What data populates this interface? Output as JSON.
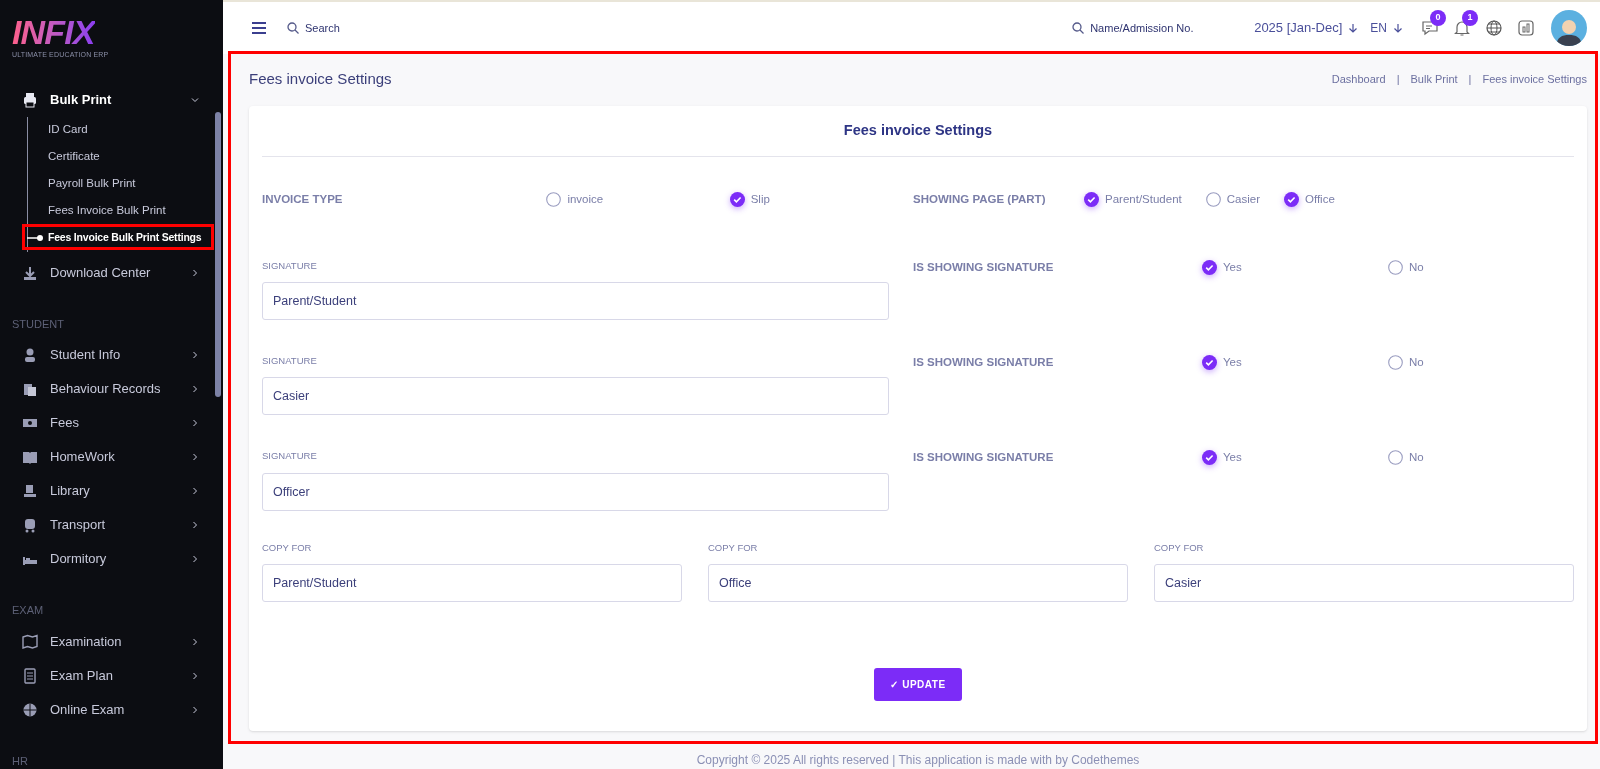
{
  "sidebar": {
    "logo": {
      "title": "INFIX",
      "subtitle": "ULTIMATE EDUCATION ERP"
    },
    "groups": [
      {
        "items": [
          {
            "label": "Bulk Print",
            "expanded": true,
            "children": [
              {
                "label": "ID Card",
                "selected": false
              },
              {
                "label": "Certificate",
                "selected": false
              },
              {
                "label": "Payroll Bulk Print",
                "selected": false
              },
              {
                "label": "Fees Invoice Bulk Print",
                "selected": false
              },
              {
                "label": "Fees Invoice Bulk Print Settings",
                "selected": true
              }
            ]
          },
          {
            "label": "Download Center",
            "expanded": false
          }
        ]
      },
      {
        "heading": "STUDENT",
        "items": [
          {
            "label": "Student Info",
            "expanded": false
          },
          {
            "label": "Behaviour Records",
            "expanded": false
          },
          {
            "label": "Fees",
            "expanded": false
          },
          {
            "label": "HomeWork",
            "expanded": false
          },
          {
            "label": "Library",
            "expanded": false
          },
          {
            "label": "Transport",
            "expanded": false
          },
          {
            "label": "Dormitory",
            "expanded": false
          }
        ]
      },
      {
        "heading": "EXAM",
        "items": [
          {
            "label": "Examination",
            "expanded": false
          },
          {
            "label": "Exam Plan",
            "expanded": false
          },
          {
            "label": "Online Exam",
            "expanded": false
          }
        ]
      },
      {
        "heading": "HR"
      }
    ]
  },
  "topbar": {
    "search": {
      "placeholder": "Search"
    },
    "student_search": {
      "placeholder": "Name/Admission No."
    },
    "session": "2025 [Jan-Dec]",
    "language": "EN",
    "message_count": "0",
    "notification_count": "1"
  },
  "page": {
    "title": "Fees invoice Settings",
    "breadcrumb": {
      "separator": "|",
      "items": [
        "Dashboard",
        "Bulk Print",
        "Fees invoice Settings"
      ]
    }
  },
  "form": {
    "title": "Fees invoice Settings",
    "invoice_type": {
      "label": "INVOICE TYPE",
      "options": [
        {
          "label": "invoice",
          "selected": false
        },
        {
          "label": "Slip",
          "selected": true
        }
      ]
    },
    "showing_page": {
      "label": "SHOWING PAGE (PART)",
      "options": [
        {
          "label": "Parent/Student",
          "checked": true
        },
        {
          "label": "Casier",
          "checked": false
        },
        {
          "label": "Office",
          "checked": true
        }
      ]
    },
    "signatures": [
      {
        "label": "SIGNATURE",
        "value": "Parent/Student",
        "showing_label": "IS SHOWING SIGNATURE",
        "options": [
          {
            "label": "Yes",
            "selected": true
          },
          {
            "label": "No",
            "selected": false
          }
        ]
      },
      {
        "label": "SIGNATURE",
        "value": "Casier",
        "showing_label": "IS SHOWING SIGNATURE",
        "options": [
          {
            "label": "Yes",
            "selected": true
          },
          {
            "label": "No",
            "selected": false
          }
        ]
      },
      {
        "label": "SIGNATURE",
        "value": "Officer",
        "showing_label": "IS SHOWING SIGNATURE",
        "options": [
          {
            "label": "Yes",
            "selected": true
          },
          {
            "label": "No",
            "selected": false
          }
        ]
      }
    ],
    "copies": [
      {
        "label": "COPY FOR",
        "value": "Parent/Student"
      },
      {
        "label": "COPY FOR",
        "value": "Office"
      },
      {
        "label": "COPY FOR",
        "value": "Casier"
      }
    ],
    "submit": "✓ UPDATE"
  },
  "footer": "Copyright © 2025 All rights reserved | This application is made with by Codethemes"
}
